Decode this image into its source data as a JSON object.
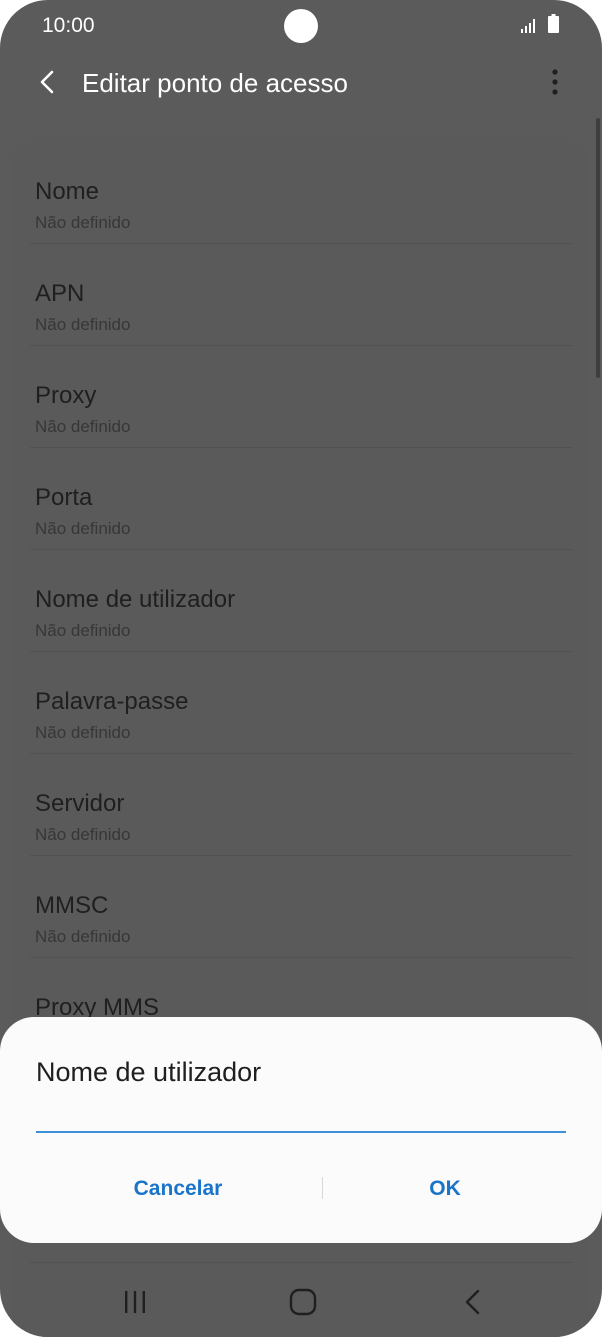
{
  "status_bar": {
    "time": "10:00"
  },
  "app_bar": {
    "title": "Editar ponto de acesso",
    "back_icon": "chevron-left-icon",
    "more_icon": "more-vertical-icon"
  },
  "settings": {
    "items": [
      {
        "title": "Nome",
        "value": "Não definido"
      },
      {
        "title": "APN",
        "value": "Não definido"
      },
      {
        "title": "Proxy",
        "value": "Não definido"
      },
      {
        "title": "Porta",
        "value": "Não definido"
      },
      {
        "title": "Nome de utilizador",
        "value": "Não definido"
      },
      {
        "title": "Palavra-passe",
        "value": "Não definido"
      },
      {
        "title": "Servidor",
        "value": "Não definido"
      },
      {
        "title": "MMSC",
        "value": "Não definido"
      },
      {
        "title": "Proxy MMS",
        "value": ""
      }
    ]
  },
  "dialog": {
    "title": "Nome de utilizador",
    "input_value": "",
    "cancel_label": "Cancelar",
    "ok_label": "OK"
  },
  "nav_bar": {
    "recents_icon": "recents-icon",
    "home_icon": "home-icon",
    "back_icon": "back-icon"
  },
  "colors": {
    "scrim_background": "#5b5b5b",
    "dialog_background": "#fbfbfb",
    "accent": "#1a74c9",
    "input_underline": "#3a8fd6"
  }
}
